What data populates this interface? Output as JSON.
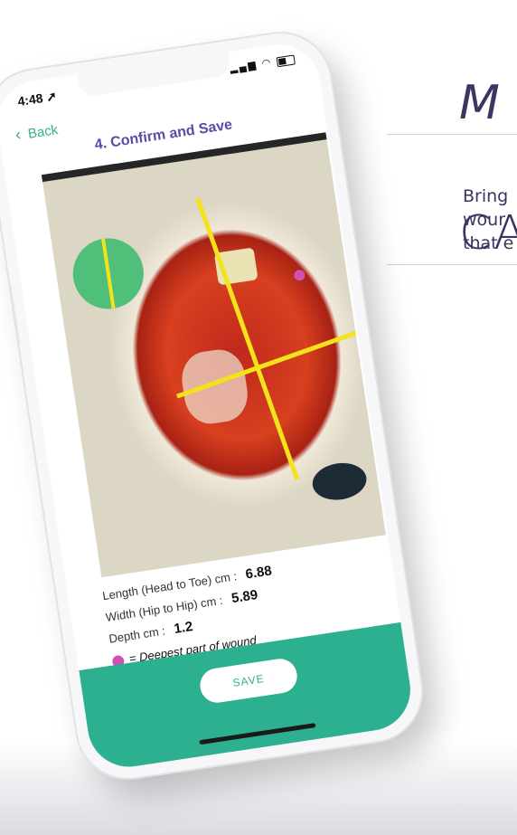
{
  "hero": {
    "title_line1": "M",
    "title_line2": "CA",
    "copy_lines": [
      "Bring",
      "wour",
      "that e"
    ]
  },
  "status_bar": {
    "time": "4:48"
  },
  "nav": {
    "back_label": "Back",
    "title": "4. Confirm and Save"
  },
  "measurements": [
    {
      "label": "Length (Head to Toe) cm :",
      "value": "6.88"
    },
    {
      "label": "Width (Hip to Hip) cm :",
      "value": "5.89"
    },
    {
      "label": "Depth cm :",
      "value": "1.2"
    }
  ],
  "legend": {
    "text": "= Deepest part of wound",
    "color": "#d24fb4"
  },
  "actions": {
    "save_label": "SAVE"
  },
  "colors": {
    "accent": "#2db08f",
    "title": "#5a4aa6",
    "measure_line": "#f2e31a"
  }
}
